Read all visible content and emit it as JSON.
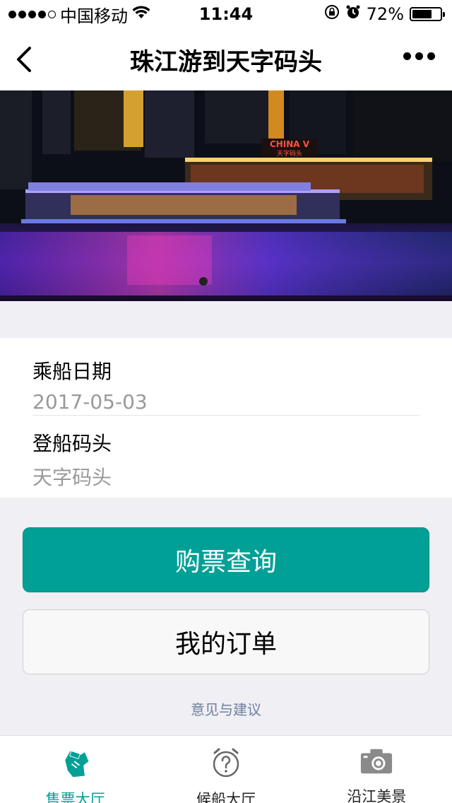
{
  "status_bar": {
    "carrier": "中国移动",
    "time": "11:44",
    "battery_percent": "72%",
    "battery_level": 0.72
  },
  "nav": {
    "title": "珠江游到天字码头"
  },
  "banner": {
    "sign_text": "CHINA V",
    "sign_subtext": "天字码头",
    "page_index": 0,
    "page_count": 1
  },
  "form": {
    "date_label": "乘船日期",
    "date_value": "2017-05-03",
    "pier_label": "登船码头",
    "pier_value": "天字码头"
  },
  "actions": {
    "query_label": "购票查询",
    "orders_label": "我的订单",
    "feedback_label": "意见与建议"
  },
  "tabs": [
    {
      "label": "售票大厅",
      "icon": "ticket-hand-icon",
      "active": true
    },
    {
      "label": "候船大厅",
      "icon": "alarm-clock-question-icon",
      "active": false
    },
    {
      "label": "沿江美景",
      "icon": "camera-icon",
      "active": false
    }
  ],
  "colors": {
    "accent": "#00a096",
    "link": "#6f7fa0",
    "background": "#efeff4"
  }
}
